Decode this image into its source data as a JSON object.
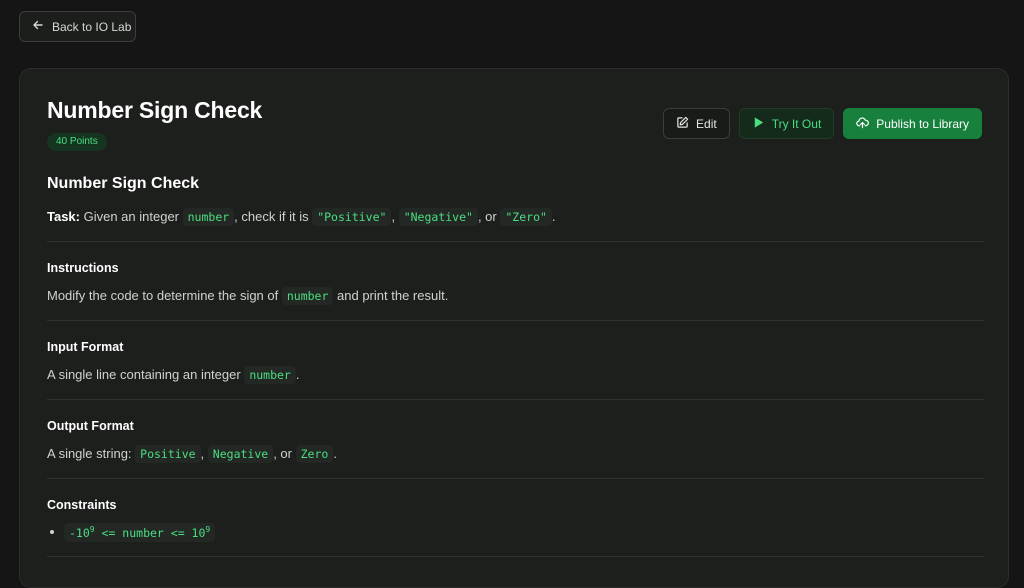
{
  "nav": {
    "back_label": "Back to IO Lab"
  },
  "problem": {
    "title": "Number Sign Check",
    "points_label": "40 Points",
    "heading": "Number Sign Check",
    "task_label": "Task:",
    "task_text_1": " Given an integer ",
    "task_code_number": "number",
    "task_text_2": ", check if it is ",
    "task_code_positive": "\"Positive\"",
    "task_sep_1": ",",
    "task_code_negative": "\"Negative\"",
    "task_sep_2": ", or",
    "task_code_zero": "\"Zero\"",
    "task_end": "."
  },
  "actions": {
    "edit_label": "Edit",
    "try_label": "Try It Out",
    "publish_label": "Publish to Library"
  },
  "sections": {
    "instructions": {
      "title": "Instructions",
      "text_1": "Modify the code to determine the sign of ",
      "code": "number",
      "text_2": " and print the result."
    },
    "input_format": {
      "title": "Input Format",
      "text_1": "A single line containing an integer ",
      "code": "number",
      "text_2": "."
    },
    "output_format": {
      "title": "Output Format",
      "text_1": "A single string: ",
      "code_1": "Positive",
      "sep_1": ",",
      "code_2": "Negative",
      "sep_2": ", or",
      "code_3": "Zero",
      "text_end": "."
    },
    "constraints": {
      "title": "Constraints",
      "items": [
        {
          "prefix": "-10",
          "exp_1": "9",
          "middle": " <= number <= 10",
          "exp_2": "9"
        }
      ]
    }
  },
  "colors": {
    "accent_green": "#4ade80",
    "publish_bg": "#17803d",
    "background": "#141514",
    "card": "#1c1f1c"
  }
}
